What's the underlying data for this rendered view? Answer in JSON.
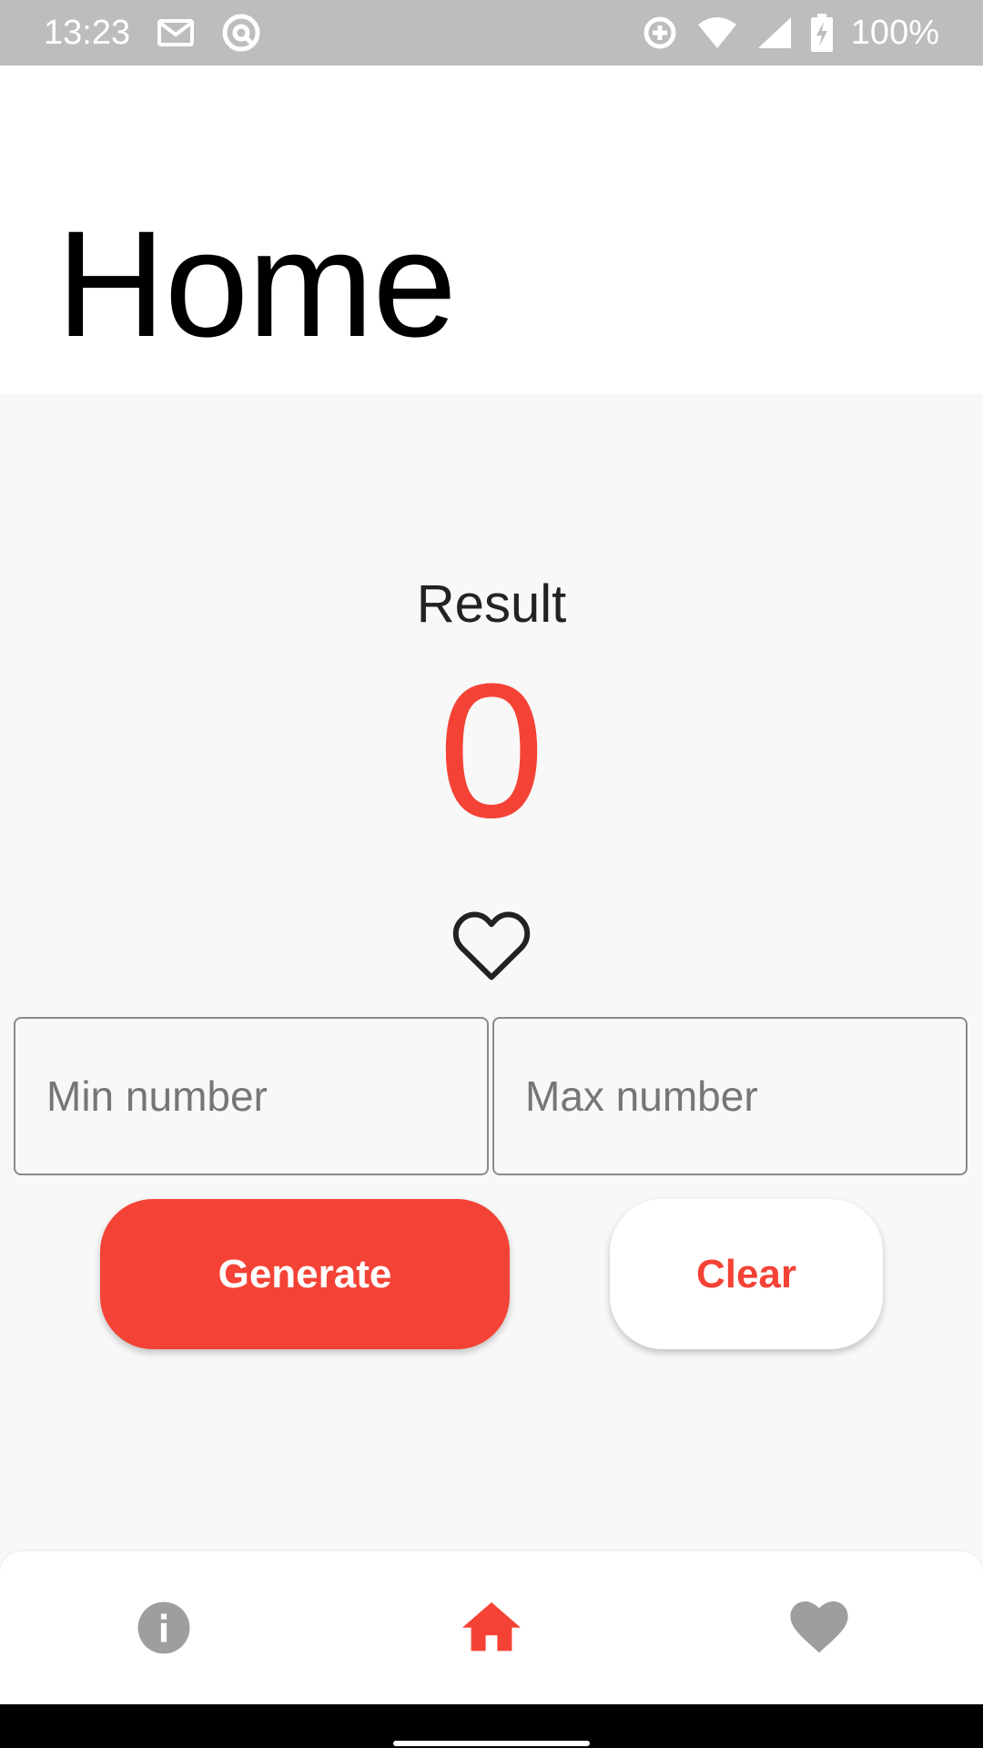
{
  "status_bar": {
    "time": "13:23",
    "battery_text": "100%",
    "icons": [
      "mail-icon",
      "at-sign-icon",
      "data-saver-icon",
      "wifi-icon",
      "signal-icon",
      "battery-charging-icon"
    ]
  },
  "header": {
    "title": "Home"
  },
  "result": {
    "label": "Result",
    "value": "0"
  },
  "favorite": {
    "icon": "heart-outline-icon",
    "favorited": false
  },
  "inputs": {
    "min": {
      "placeholder": "Min number",
      "value": ""
    },
    "max": {
      "placeholder": "Max number",
      "value": ""
    }
  },
  "buttons": {
    "generate_label": "Generate",
    "clear_label": "Clear"
  },
  "bottom_nav": {
    "items": [
      {
        "name": "info",
        "icon": "info-icon",
        "active": false
      },
      {
        "name": "home",
        "icon": "home-icon",
        "active": true
      },
      {
        "name": "favorites",
        "icon": "heart-icon",
        "active": false
      }
    ]
  },
  "colors": {
    "accent": "#f44336",
    "status_bar": "#bdbdbd",
    "inactive_icon": "#9e9e9e",
    "background": "#f8f8f8"
  }
}
